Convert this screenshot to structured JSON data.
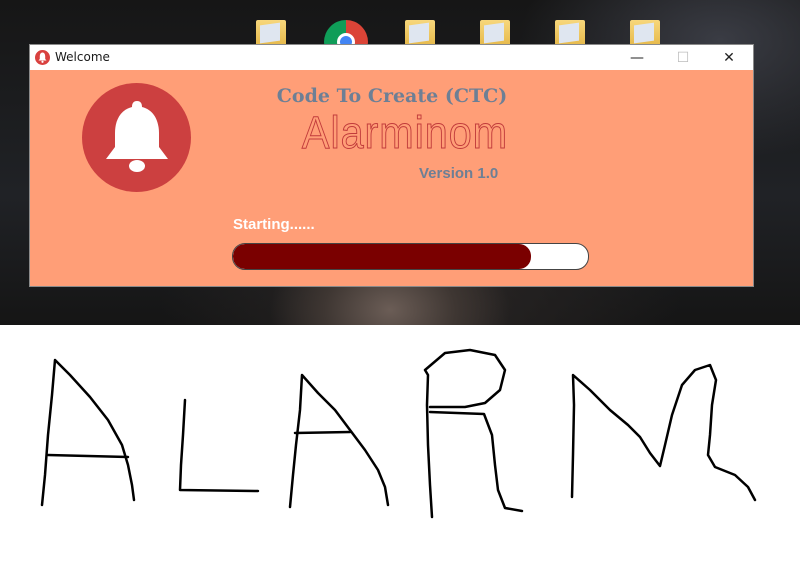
{
  "window": {
    "title": "Welcome",
    "controls": {
      "minimize": "—",
      "maximize": "☐",
      "close": "✕"
    }
  },
  "splash": {
    "company": "Code To Create (CTC)",
    "app_name": "Alarminom",
    "version": "Version 1.0",
    "status": "Starting......",
    "progress": 0.84
  },
  "colors": {
    "window_bg": "#ff9e77",
    "bell_circle": "#cc4040",
    "progress_fill": "#7a0000",
    "text_muted": "#6d7f95"
  },
  "icons": {
    "app": "bell-icon",
    "logo": "bell-icon"
  }
}
